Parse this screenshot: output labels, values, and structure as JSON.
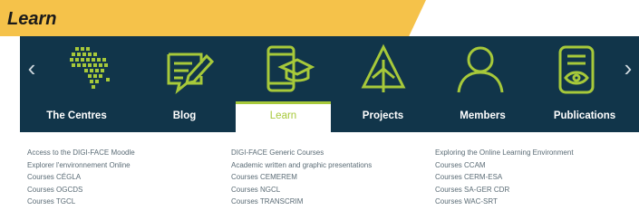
{
  "banner": {
    "title": "Learn",
    "color": "#f5c24a"
  },
  "colors": {
    "dark": "#11354a",
    "accent": "#a7c93a"
  },
  "carousel": {
    "prev_icon": "chevron-left-icon",
    "next_icon": "chevron-right-icon",
    "icons": [
      "africa-map-icon",
      "edit-note-icon",
      "mobile-graduation-icon",
      "tree-icon",
      "person-icon",
      "document-eye-icon"
    ]
  },
  "nav": {
    "items": [
      {
        "label": "The Centres",
        "active": false
      },
      {
        "label": "Blog",
        "active": false
      },
      {
        "label": "Learn",
        "active": true
      },
      {
        "label": "Projects",
        "active": false
      },
      {
        "label": "Members",
        "active": false
      },
      {
        "label": "Publications",
        "active": false
      }
    ]
  },
  "links": {
    "col1": [
      "Access to the DIGI-FACE Moodle",
      "Explorer l'environnement Online",
      "Courses CÉGLA",
      "Courses OGCDS",
      "Courses TGCL"
    ],
    "col2": [
      "DIGI-FACE Generic Courses",
      "Academic written and graphic presentations",
      "Courses CEMEREM",
      "Courses NGCL",
      "Courses TRANSCRIM"
    ],
    "col3": [
      "Exploring the Online Learning Environment",
      "Courses CCAM",
      "Courses CERM-ESA",
      "Courses SA-GER CDR",
      "Courses WAC-SRT"
    ]
  }
}
